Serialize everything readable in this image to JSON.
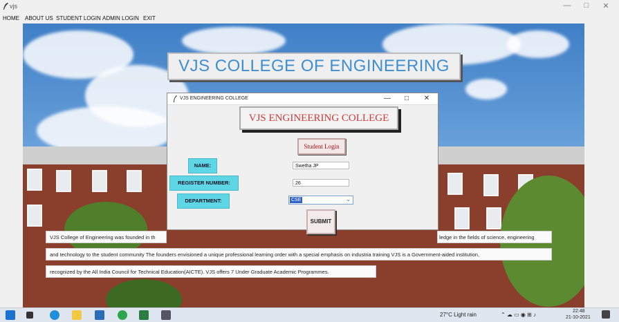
{
  "window": {
    "title": "vjs",
    "controls": [
      "—",
      "□",
      "✕"
    ]
  },
  "menu": [
    "HOME",
    "ABOUT US",
    "STUDENT LOGIN",
    "ADMIN LOGIN",
    "EXIT"
  ],
  "banner": "VJS COLLEGE OF ENGINEERING",
  "dialog": {
    "title": "VJS ENGINEERING COLLEGE",
    "controls": [
      "—",
      "□",
      "✕"
    ],
    "heading": "VJS ENGINEERING COLLEGE",
    "student_login_button": "Student Login",
    "name_label": "NAME:",
    "name_value": "Swetha JP",
    "register_label": "REGISTER NUMBER:",
    "register_value": "26",
    "department_label": "DEPARTMENT:",
    "department_value": "CSE",
    "submit_label": "SUBMIT"
  },
  "description": [
    "VJS College of Engineering was founded in th",
    "ledge in the fields of science, engineering",
    "and technology to the student community The founders envisioned a unique professional learning order with a special emphasis on industria training  VJS is a Government-aided institution,",
    "recognized by the All India Council for Technical Education(AICTE). VJS offers 7 Under Graduate Academic Programmes."
  ],
  "taskbar": {
    "weather": "27°C  Light rain",
    "time": "22:48",
    "date": "21-10-2021"
  },
  "colors": {
    "banner_text": "#3f8fd0",
    "dialog_heading": "#d23a3a",
    "label_bg": "#5fd6e6",
    "select_highlight": "#2f62c7"
  }
}
